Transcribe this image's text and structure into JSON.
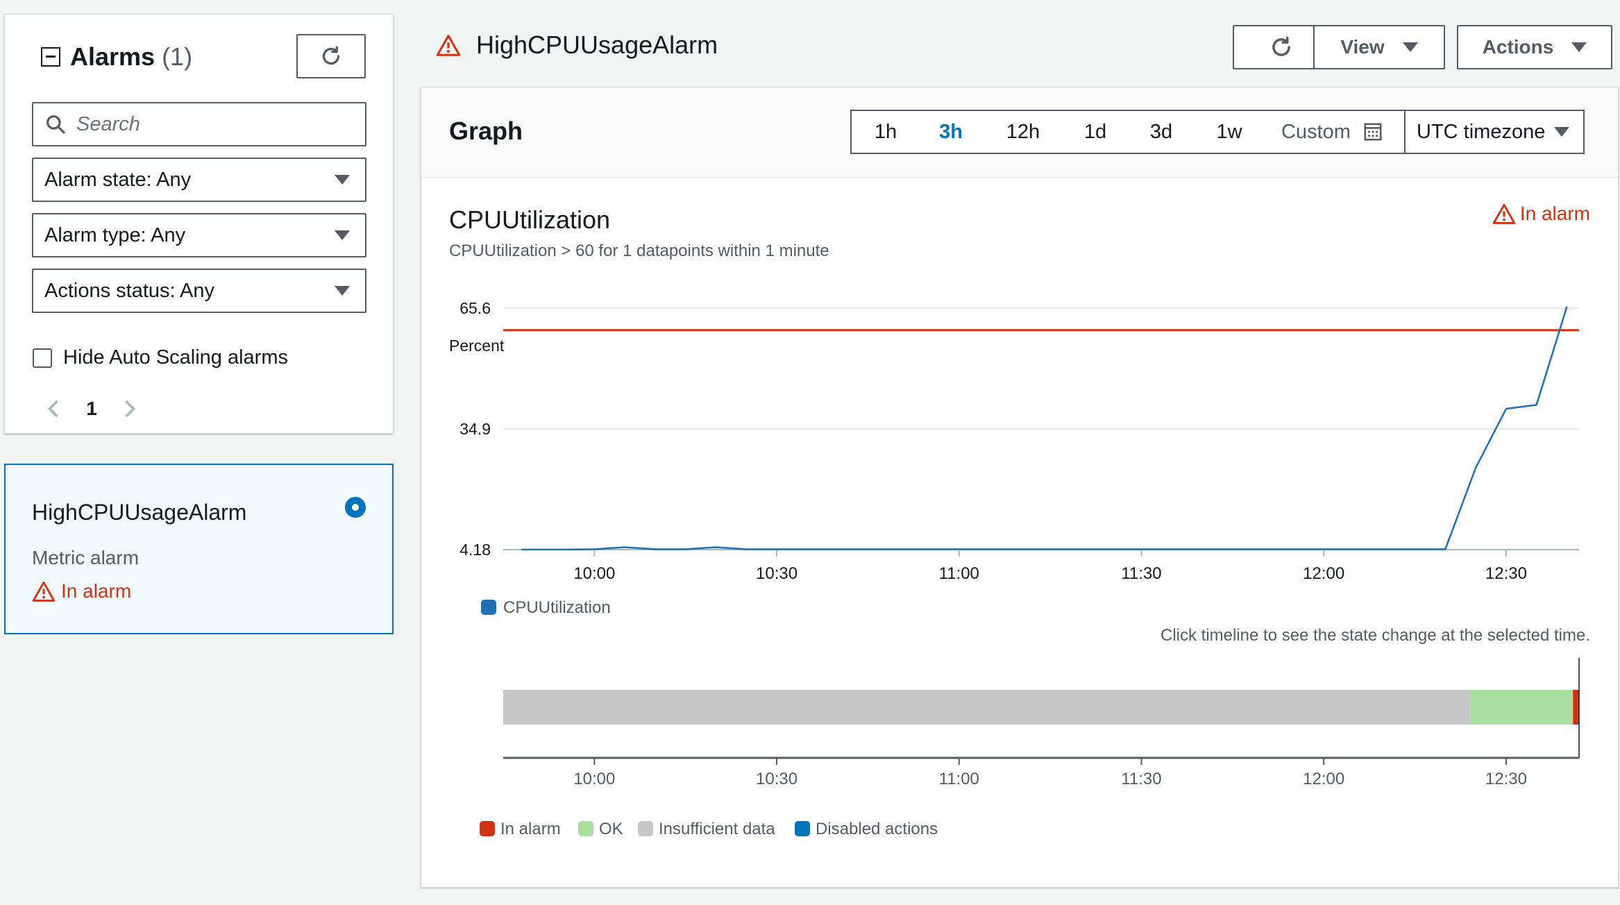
{
  "sidebar": {
    "title": "Alarms",
    "count": "(1)",
    "search_placeholder": "Search",
    "filters": [
      {
        "label": "Alarm state: Any"
      },
      {
        "label": "Alarm type: Any"
      },
      {
        "label": "Actions status: Any"
      }
    ],
    "checkbox_label": "Hide Auto Scaling alarms",
    "checkbox_checked": false,
    "page": "1"
  },
  "alarm_card": {
    "name": "HighCPUUsageAlarm",
    "type": "Metric alarm",
    "status": "In alarm"
  },
  "header": {
    "title": "HighCPUUsageAlarm",
    "view_label": "View",
    "actions_label": "Actions"
  },
  "graph": {
    "title": "Graph",
    "ranges": [
      "1h",
      "3h",
      "12h",
      "1d",
      "3d",
      "1w"
    ],
    "active_range": "3h",
    "custom_label": "Custom",
    "timezone": "UTC timezone",
    "metric_title": "CPUUtilization",
    "metric_subtitle": "CPUUtilization > 60 for 1 datapoints within 1 minute",
    "state": "In alarm",
    "timeline_hint": "Click timeline to see the state change at the selected time."
  },
  "colors": {
    "alarm_red": "#d13212",
    "accent_blue": "#0073bb",
    "ok_green": "#a9e0a0",
    "insufficient_gray": "#c6c6c6",
    "line_blue": "#1f6fb2"
  },
  "chart_data": [
    {
      "type": "line",
      "ylabel": "Percent",
      "yticks": [
        "65.6",
        "34.9",
        "4.18"
      ],
      "ylim": [
        4.18,
        65.6
      ],
      "xticks": [
        "10:00",
        "10:30",
        "11:00",
        "11:30",
        "12:00",
        "12:30"
      ],
      "xlim": [
        "09:45",
        "12:42"
      ],
      "threshold": 60,
      "series": [
        {
          "name": "CPUUtilization",
          "x": [
            "09:48",
            "09:55",
            "10:00",
            "10:05",
            "10:10",
            "10:15",
            "10:20",
            "10:25",
            "10:30",
            "11:00",
            "11:30",
            "12:00",
            "12:20",
            "12:25",
            "12:30",
            "12:35",
            "12:40"
          ],
          "values": [
            4.2,
            4.2,
            4.3,
            4.8,
            4.3,
            4.3,
            4.8,
            4.3,
            4.3,
            4.3,
            4.3,
            4.3,
            4.3,
            25,
            40,
            41,
            66
          ]
        }
      ]
    },
    {
      "type": "bar",
      "xticks": [
        "10:00",
        "10:30",
        "11:00",
        "11:30",
        "12:00",
        "12:30"
      ],
      "segments": [
        {
          "state": "Insufficient data",
          "start": "09:45",
          "end": "12:24"
        },
        {
          "state": "OK",
          "start": "12:24",
          "end": "12:41"
        },
        {
          "state": "In alarm",
          "start": "12:41",
          "end": "12:42"
        }
      ],
      "legend": [
        "In alarm",
        "OK",
        "Insufficient data",
        "Disabled actions"
      ]
    }
  ]
}
